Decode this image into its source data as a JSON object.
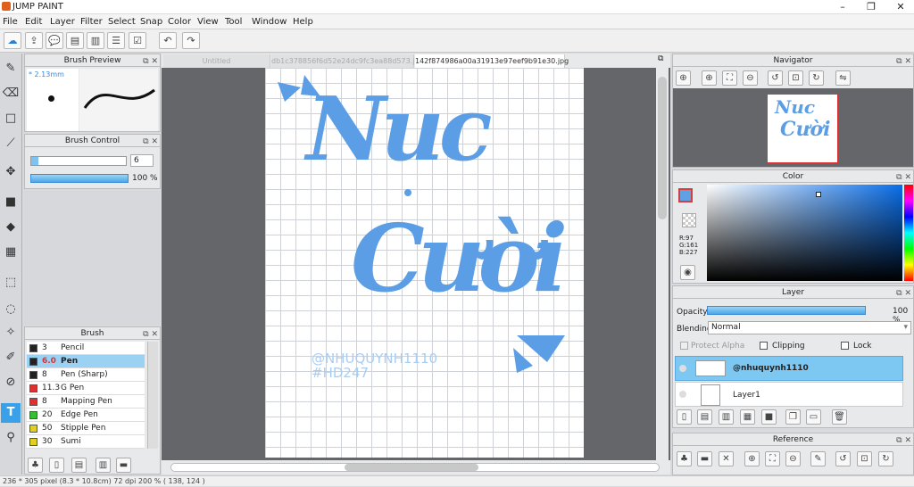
{
  "app": {
    "title": "JUMP PAINT"
  },
  "window_controls": {
    "minimize": "–",
    "restore": "❐",
    "close": "✕"
  },
  "menu": [
    "File",
    "Edit",
    "Layer",
    "Filter",
    "Select",
    "Snap",
    "Color",
    "View",
    "Tool",
    "Window",
    "Help"
  ],
  "brush_preview": {
    "title": "Brush Preview",
    "size": "* 2.13mm"
  },
  "brush_control": {
    "title": "Brush Control",
    "size": "6",
    "opacity": "100 %"
  },
  "brush_panel": {
    "title": "Brush",
    "items": [
      {
        "size": "3",
        "name": "Pencil",
        "color": "#222222"
      },
      {
        "size": "6.0",
        "name": "Pen",
        "color": "#222222"
      },
      {
        "size": "8",
        "name": "Pen (Sharp)",
        "color": "#222222"
      },
      {
        "size": "11.3",
        "name": "G Pen",
        "color": "#e03030"
      },
      {
        "size": "8",
        "name": "Mapping Pen",
        "color": "#e03030"
      },
      {
        "size": "20",
        "name": "Edge Pen",
        "color": "#30c030"
      },
      {
        "size": "50",
        "name": "Stipple Pen",
        "color": "#e0d020"
      },
      {
        "size": "30",
        "name": "Sumi",
        "color": "#e0d020"
      }
    ]
  },
  "tabs": [
    "Untitled",
    "db1c378856f6d52e24dc9fc3ea88d573.jpg",
    "142f874986a00a31913e97eef9b91e30.jpg"
  ],
  "canvas": {
    "line1": "Nuc",
    "line2": "Cười",
    "sign1": "@NHUQUYNH1110",
    "sign2": "#HD247",
    "accent": "#5b9ee6"
  },
  "navigator": {
    "title": "Navigator"
  },
  "color_panel": {
    "title": "Color",
    "r": "R:97",
    "g": "G:161",
    "b": "B:227",
    "current": "#61a1e3"
  },
  "layer_panel": {
    "title": "Layer",
    "opacity_label": "Opacity",
    "opacity_value": "100 %",
    "blending_label": "Blending",
    "blending_value": "Normal",
    "protect_alpha": "Protect Alpha",
    "clipping": "Clipping",
    "lock": "Lock",
    "layers": [
      {
        "name": "@nhuquynh1110"
      },
      {
        "name": "Layer1"
      }
    ]
  },
  "reference": {
    "title": "Reference"
  },
  "status": "236 * 305 pixel   (8.3 * 10.8cm)   72 dpi   200 %   ( 138, 124 )"
}
